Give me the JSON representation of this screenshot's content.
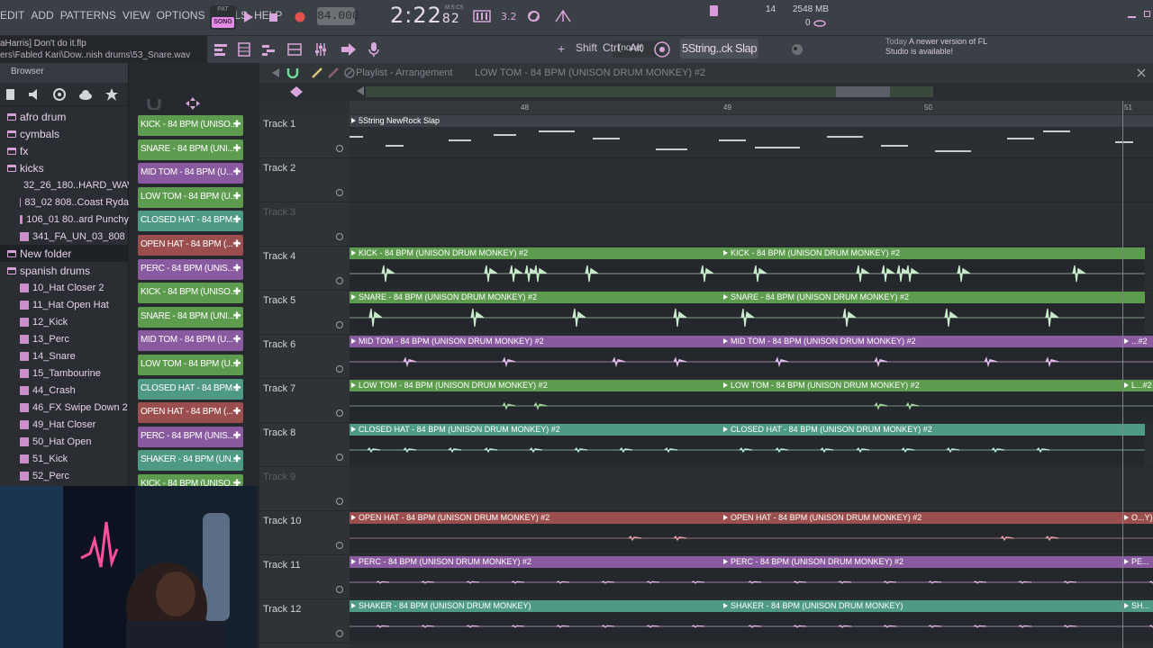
{
  "menu": {
    "items": [
      "EDIT",
      "ADD",
      "PATTERNS",
      "VIEW",
      "OPTIONS",
      "TOOLS",
      "HELP"
    ]
  },
  "transport": {
    "pat_label": "PAT",
    "song_label": "SONG",
    "tempo": "84.000",
    "time_main": "2:22",
    "time_sub": "82",
    "mcs": "M:S:CS"
  },
  "cpu": {
    "cpu_value": "14",
    "memory": "2548 MB",
    "poly": "0"
  },
  "hint": {
    "line1": "aHarris] Don't do it.flp",
    "line2": "ers\\Fabled Kari\\Dow..nish drums\\53_Snare.wav"
  },
  "toolbar": {
    "pattern_none": "(none)",
    "pattern_name": "5String..ck Slap",
    "shift": "Shift",
    "ctrl": "Ctrl",
    "alt": "Alt"
  },
  "news": {
    "today": "Today",
    "message": "A newer version of FL Studio is available!"
  },
  "browser": {
    "title": "Browser",
    "items": [
      {
        "label": "afro drum",
        "type": "folder"
      },
      {
        "label": "cymbals",
        "type": "folder"
      },
      {
        "label": "fx",
        "type": "folder"
      },
      {
        "label": "kicks",
        "type": "folder"
      },
      {
        "label": "32_26_180..HARD_WAV",
        "type": "file"
      },
      {
        "label": "83_02 808..Coast Ryda",
        "type": "file"
      },
      {
        "label": "106_01 80..ard Punchy",
        "type": "file"
      },
      {
        "label": "341_FA_UN_03_808",
        "type": "file"
      },
      {
        "label": "New folder",
        "type": "folder"
      },
      {
        "label": "spanish drums",
        "type": "folder"
      },
      {
        "label": "10_Hat Closer 2",
        "type": "file"
      },
      {
        "label": "11_Hat Open Hat",
        "type": "file"
      },
      {
        "label": "12_Kick",
        "type": "file"
      },
      {
        "label": "13_Perc",
        "type": "file"
      },
      {
        "label": "14_Snare",
        "type": "file"
      },
      {
        "label": "15_Tambourine",
        "type": "file"
      },
      {
        "label": "44_Crash",
        "type": "file"
      },
      {
        "label": "46_FX Swipe Down 2",
        "type": "file"
      },
      {
        "label": "49_Hat Closer",
        "type": "file"
      },
      {
        "label": "50_Hat Open",
        "type": "file"
      },
      {
        "label": "51_Kick",
        "type": "file"
      },
      {
        "label": "52_Perc",
        "type": "file"
      }
    ]
  },
  "channels": [
    {
      "label": "KICK - 84 BPM (UNISO...",
      "color": "#5d9b4f"
    },
    {
      "label": "SNARE - 84 BPM (UNI...",
      "color": "#5d9b4f"
    },
    {
      "label": "MID TOM - 84 BPM (U...",
      "color": "#8a5aa0"
    },
    {
      "label": "LOW TOM - 84 BPM (U...",
      "color": "#5d9b4f"
    },
    {
      "label": "CLOSED HAT - 84 BPM...",
      "color": "#4f9a84"
    },
    {
      "label": "OPEN HAT - 84 BPM (...",
      "color": "#9b4e4e"
    },
    {
      "label": "PERC - 84 BPM (UNIS...",
      "color": "#8a5aa0"
    },
    {
      "label": "KICK - 84 BPM (UNISO...",
      "color": "#5d9b4f"
    },
    {
      "label": "SNARE - 84 BPM (UNI...",
      "color": "#5d9b4f"
    },
    {
      "label": "MID TOM - 84 BPM (U...",
      "color": "#8a5aa0"
    },
    {
      "label": "LOW TOM - 84 BPM (U...",
      "color": "#5d9b4f"
    },
    {
      "label": "CLOSED HAT - 84 BPM...",
      "color": "#4f9a84"
    },
    {
      "label": "OPEN HAT - 84 BPM (...",
      "color": "#9b4e4e"
    },
    {
      "label": "PERC - 84 BPM (UNIS...",
      "color": "#8a5aa0"
    },
    {
      "label": "SHAKER - 84 BPM (UN...",
      "color": "#4f9a84"
    },
    {
      "label": "KICK - 84 BPM (UNISO...",
      "color": "#5d9b4f"
    }
  ],
  "playlist": {
    "title": "Playlist - Arrangement",
    "subtitle": "LOW TOM - 84 BPM (UNISON DRUM MONKEY) #2",
    "ruler": [
      "48",
      "49",
      "50",
      "51"
    ],
    "tracks": [
      {
        "label": "Track 1",
        "muted": false,
        "clips": [
          {
            "name": "5String NewRock Slap",
            "color": "#2b2f34",
            "hdr": "#3d4248",
            "kind": "notes"
          }
        ]
      },
      {
        "label": "Track 2",
        "muted": false,
        "clips": []
      },
      {
        "label": "Track 3",
        "muted": true,
        "clips": []
      },
      {
        "label": "Track 4",
        "muted": false,
        "clips": [
          {
            "name": "KICK - 84 BPM (UNISON DRUM MONKEY) #2",
            "color": "#5d9b4f",
            "kind": "kick"
          },
          {
            "name": "KICK - 84 BPM (UNISON DRUM MONKEY) #2",
            "color": "#5d9b4f",
            "kind": "kick"
          }
        ]
      },
      {
        "label": "Track 5",
        "muted": false,
        "clips": [
          {
            "name": "SNARE - 84 BPM (UNISON DRUM MONKEY) #2",
            "color": "#5d9b4f",
            "kind": "snare"
          },
          {
            "name": "SNARE - 84 BPM (UNISON DRUM MONKEY) #2",
            "color": "#5d9b4f",
            "kind": "snare"
          }
        ]
      },
      {
        "label": "Track 6",
        "muted": false,
        "clips": [
          {
            "name": "MID TOM - 84 BPM (UNISON DRUM MONKEY) #2",
            "color": "#8a5aa0",
            "kind": "tom"
          },
          {
            "name": "MID TOM - 84 BPM (UNISON DRUM MONKEY) #2",
            "color": "#8a5aa0",
            "kind": "tom"
          },
          {
            "name": "...#2",
            "color": "#8a5aa0",
            "kind": "tom"
          }
        ]
      },
      {
        "label": "Track 7",
        "muted": false,
        "clips": [
          {
            "name": "LOW TOM - 84 BPM (UNISON DRUM MONKEY) #2",
            "color": "#5d9b4f",
            "kind": "lowtom"
          },
          {
            "name": "LOW TOM - 84 BPM (UNISON DRUM MONKEY) #2",
            "color": "#5d9b4f",
            "kind": "lowtom"
          },
          {
            "name": "L...#2",
            "color": "#5d9b4f",
            "kind": "lowtom"
          }
        ]
      },
      {
        "label": "Track 8",
        "muted": false,
        "clips": [
          {
            "name": "CLOSED HAT - 84 BPM (UNISON DRUM MONKEY) #2",
            "color": "#4f9a84",
            "kind": "hat"
          },
          {
            "name": "CLOSED HAT - 84 BPM (UNISON DRUM MONKEY) #2",
            "color": "#4f9a84",
            "kind": "hat"
          }
        ]
      },
      {
        "label": "Track 9",
        "muted": true,
        "clips": []
      },
      {
        "label": "Track 10",
        "muted": false,
        "clips": [
          {
            "name": "OPEN HAT - 84 BPM (UNISON DRUM MONKEY) #2",
            "color": "#9b4e4e",
            "kind": "open"
          },
          {
            "name": "OPEN HAT - 84 BPM (UNISON DRUM MONKEY) #2",
            "color": "#9b4e4e",
            "kind": "open"
          },
          {
            "name": "O...Y)",
            "color": "#9b4e4e",
            "kind": "open"
          }
        ]
      },
      {
        "label": "Track 11",
        "muted": false,
        "clips": [
          {
            "name": "PERC - 84 BPM (UNISON DRUM MONKEY) #2",
            "color": "#8a5aa0",
            "kind": "perc"
          },
          {
            "name": "PERC - 84 BPM (UNISON DRUM MONKEY) #2",
            "color": "#8a5aa0",
            "kind": "perc"
          },
          {
            "name": "PE...",
            "color": "#8a5aa0",
            "kind": "perc"
          }
        ]
      },
      {
        "label": "Track 12",
        "muted": false,
        "clips": [
          {
            "name": "SHAKER - 84 BPM (UNISON DRUM MONKEY)",
            "color": "#4f9a84",
            "kind": "perc"
          },
          {
            "name": "SHAKER - 84 BPM (UNISON DRUM MONKEY)",
            "color": "#4f9a84",
            "kind": "perc"
          },
          {
            "name": "SH...",
            "color": "#4f9a84",
            "kind": "perc"
          }
        ]
      }
    ]
  }
}
